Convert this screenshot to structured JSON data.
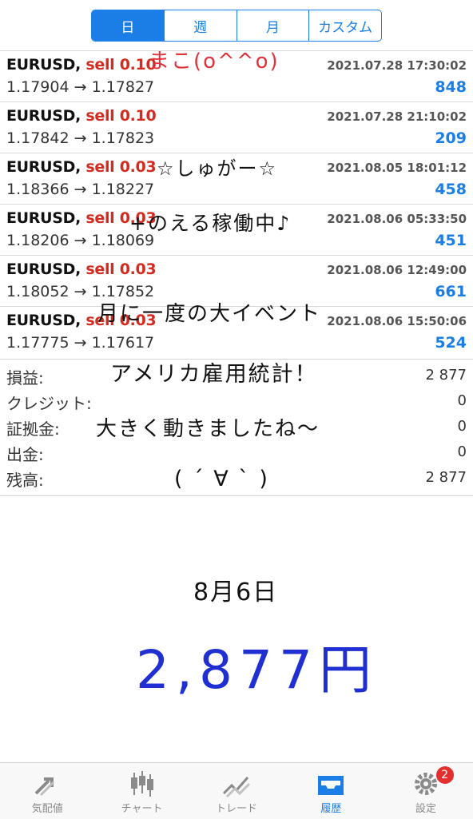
{
  "period_tabs": [
    {
      "label": "日",
      "active": true
    },
    {
      "label": "週",
      "active": false
    },
    {
      "label": "月",
      "active": false
    },
    {
      "label": "カスタム",
      "active": false
    }
  ],
  "trades": [
    {
      "symbol": "EURUSD,",
      "side": "sell 0.10",
      "datetime": "2021.07.28 17:30:02",
      "prices": "1.17904 → 1.17827",
      "profit": "848"
    },
    {
      "symbol": "EURUSD,",
      "side": "sell 0.10",
      "datetime": "2021.07.28 21:10:02",
      "prices": "1.17842 → 1.17823",
      "profit": "209"
    },
    {
      "symbol": "EURUSD,",
      "side": "sell 0.03",
      "datetime": "2021.08.05 18:01:12",
      "prices": "1.18366 → 1.18227",
      "profit": "458"
    },
    {
      "symbol": "EURUSD,",
      "side": "sell 0.03",
      "datetime": "2021.08.06 05:33:50",
      "prices": "1.18206 → 1.18069",
      "profit": "451"
    },
    {
      "symbol": "EURUSD,",
      "side": "sell 0.03",
      "datetime": "2021.08.06 12:49:00",
      "prices": "1.18052 → 1.17852",
      "profit": "661"
    },
    {
      "symbol": "EURUSD,",
      "side": "sell 0.03",
      "datetime": "2021.08.06 15:50:06",
      "prices": "1.17775 → 1.17617",
      "profit": "524"
    }
  ],
  "summary": [
    {
      "label": "損益:",
      "value": "2 877"
    },
    {
      "label": "クレジット:",
      "value": "0"
    },
    {
      "label": "証拠金:",
      "value": "0"
    },
    {
      "label": "出金:",
      "value": "0"
    },
    {
      "label": "残高:",
      "value": "2 877"
    }
  ],
  "handwriting": {
    "name": "まこ(o^^o)",
    "line1": "☆しゅがー☆",
    "line2": "+のえる稼働中♪",
    "line3": "月に一度の大イベント",
    "line4": "アメリカ雇用統計！",
    "line5": "大きく動きましたね〜",
    "line6": "( ´ ∀ ` )",
    "date": "8月6日",
    "total": "2,877円"
  },
  "colors": {
    "accent": "#1a7ee6",
    "sell": "#d42b20",
    "total_ink": "#1f2fd1",
    "name_ink": "#e0323a",
    "badge": "#e3302f"
  },
  "tabbar": [
    {
      "label": "気配値",
      "icon": "quotes-arrows-icon",
      "active": false
    },
    {
      "label": "チャート",
      "icon": "candlestick-chart-icon",
      "active": false
    },
    {
      "label": "トレード",
      "icon": "trade-trend-icon",
      "active": false
    },
    {
      "label": "履歴",
      "icon": "history-inbox-icon",
      "active": true
    },
    {
      "label": "設定",
      "icon": "settings-gear-icon",
      "active": false,
      "badge": "2"
    }
  ]
}
